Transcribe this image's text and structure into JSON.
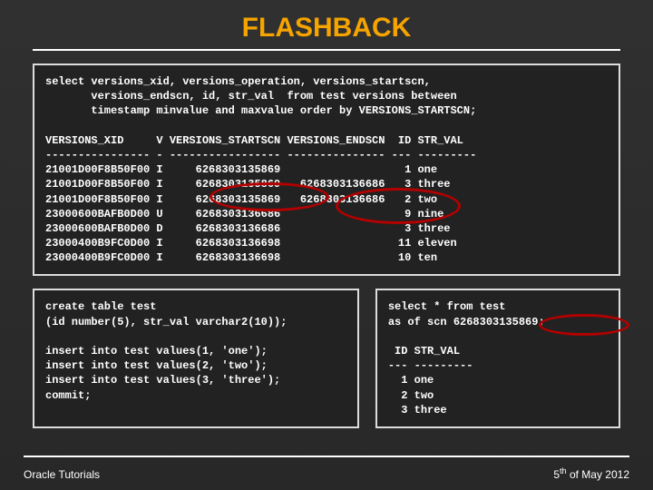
{
  "title": "FLASHBACK",
  "top_panel": "select versions_xid, versions_operation, versions_startscn,\n       versions_endscn, id, str_val  from test versions between\n       timestamp minvalue and maxvalue order by VERSIONS_STARTSCN;\n\nVERSIONS_XID     V VERSIONS_STARTSCN VERSIONS_ENDSCN  ID STR_VAL\n---------------- - ----------------- --------------- --- ---------\n21001D00F8B50F00 I     6268303135869                   1 one\n21001D00F8B50F00 I     6268303135869   6268303136686   3 three\n21001D00F8B50F00 I     6268303135869   6268303136686   2 two\n23000600BAFB0D00 U     6268303136686                   9 nine\n23000600BAFB0D00 D     6268303136686                   3 three\n23000400B9FC0D00 I     6268303136698                  11 eleven\n23000400B9FC0D00 I     6268303136698                  10 ten",
  "left_panel": "create table test\n(id number(5), str_val varchar2(10));\n\ninsert into test values(1, 'one');\ninsert into test values(2, 'two');\ninsert into test values(3, 'three');\ncommit;",
  "right_panel": "select * from test\nas of scn 6268303135869;\n\n ID STR_VAL\n--- ---------\n  1 one\n  2 two\n  3 three",
  "footer": {
    "left": "Oracle Tutorials",
    "right_pre": "5",
    "right_sup": "th",
    "right_post": " of May 2012"
  }
}
